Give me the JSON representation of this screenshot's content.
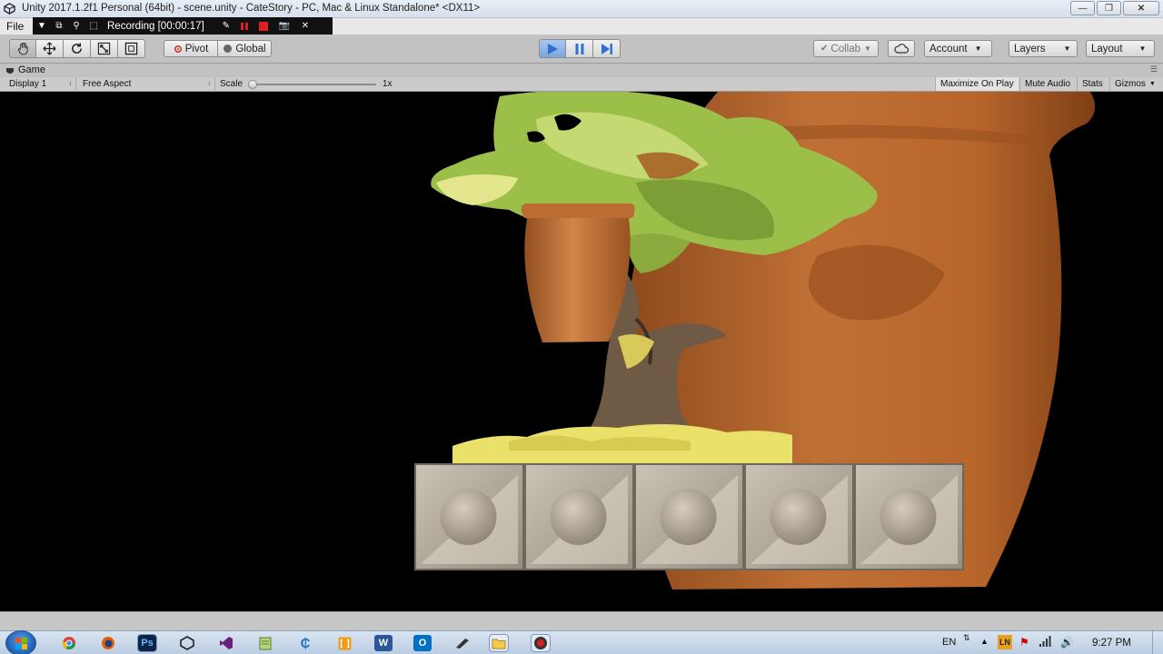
{
  "window": {
    "title": "Unity 2017.1.2f1 Personal (64bit) - scene.unity - CateStory - PC, Mac & Linux Standalone* <DX11>"
  },
  "menu": {
    "file": "File"
  },
  "recording": {
    "label": "Recording [00:00:17]"
  },
  "toolbar": {
    "pivot": "Pivot",
    "global": "Global",
    "collab": "Collab",
    "account": "Account",
    "layers": "Layers",
    "layout": "Layout"
  },
  "game_tab": {
    "label": "Game"
  },
  "game_bar": {
    "display": "Display 1",
    "aspect": "Free Aspect",
    "scale_label": "Scale",
    "scale_value": "1x",
    "scale_level": 0,
    "maximize_on_play": "Maximize On Play",
    "mute_audio": "Mute Audio",
    "stats": "Stats",
    "gizmos": "Gizmos"
  },
  "scene": {
    "tiles": 5,
    "colors": {
      "big_pot": "#b9662b",
      "small_pot": "#c5733a",
      "foliage": "#9fbf4a",
      "tile": "#b1a99d"
    }
  },
  "taskbar": {
    "apps": [
      "chrome-icon",
      "firefox-icon",
      "photoshop-icon",
      "unity-icon",
      "visual-studio-icon",
      "notepad-icon",
      "edge-icon",
      "brackets-icon",
      "word-icon",
      "outlook-icon",
      "pen-icon",
      "folder-icon",
      "recorder-icon"
    ],
    "language": "EN",
    "clock": "9:27 PM"
  },
  "colors": {
    "toolbar_bg": "#c2c2c2",
    "accent_play": "#4f8fdc",
    "record_red": "#e02020"
  }
}
